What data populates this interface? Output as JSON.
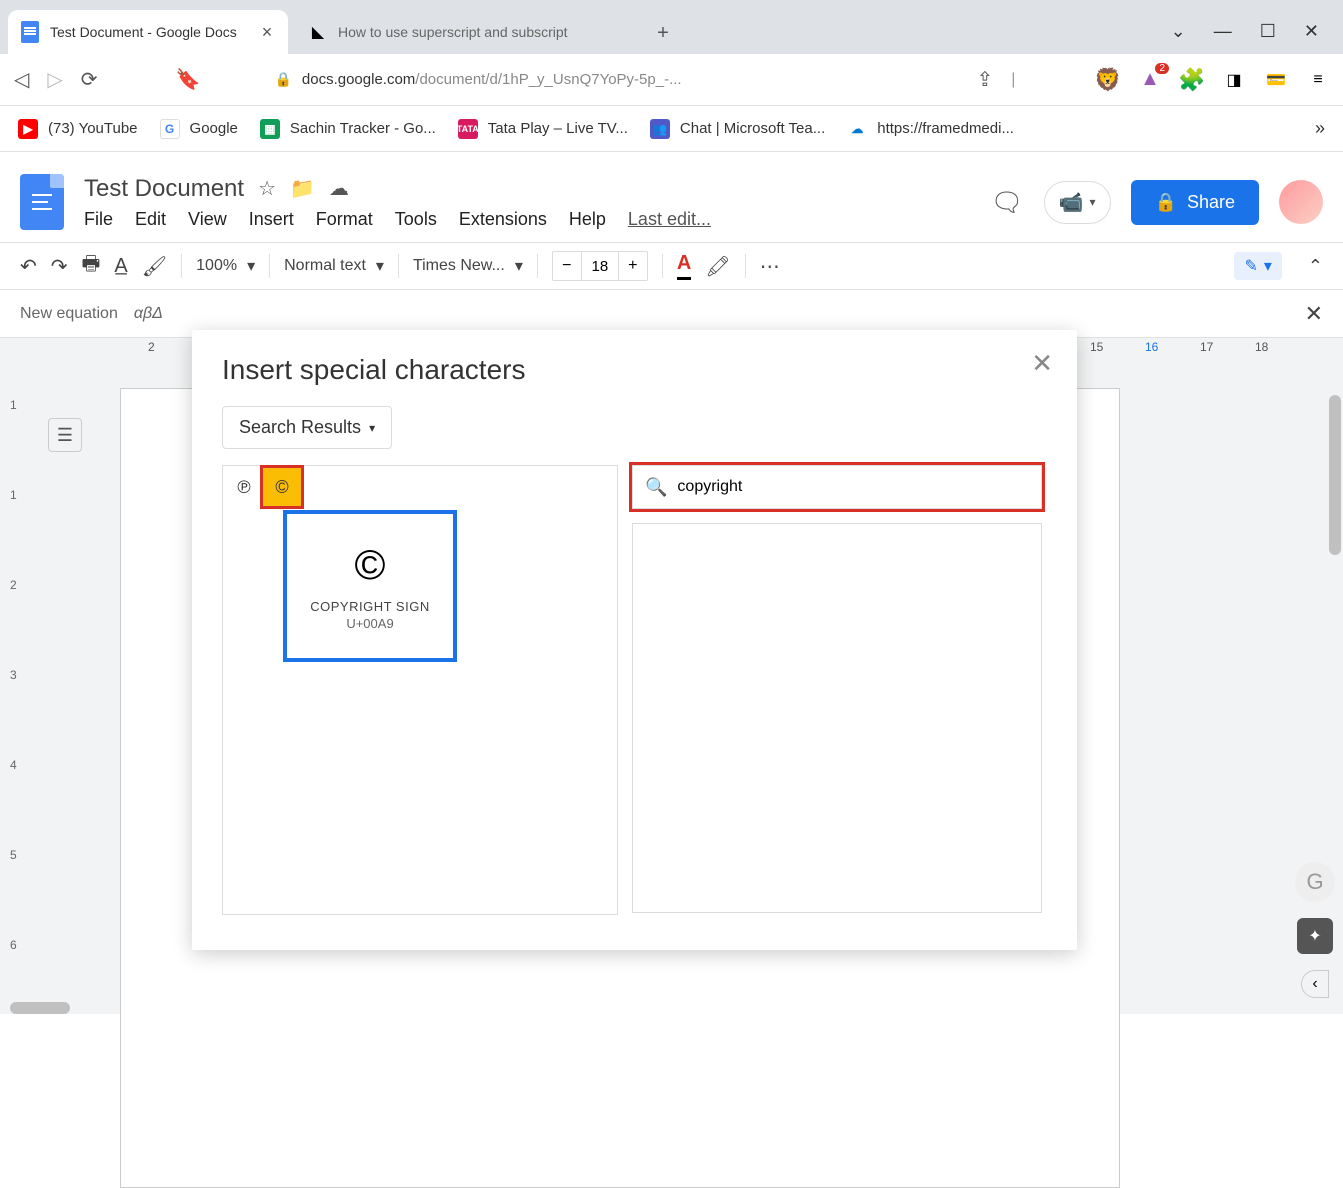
{
  "browser": {
    "tabs": [
      {
        "title": "Test Document - Google Docs",
        "active": true
      },
      {
        "title": "How to use superscript and subscript",
        "active": false
      }
    ],
    "url_host": "docs.google.com",
    "url_path": "/document/d/1hP_y_UsnQ7YoPy-5p_-...",
    "bookmarks": [
      {
        "label": "(73) YouTube",
        "color": "#ff0000",
        "glyph": "▶"
      },
      {
        "label": "Google",
        "color": "#fff",
        "glyph": "G"
      },
      {
        "label": "Sachin Tracker - Go...",
        "color": "#0f9d58",
        "glyph": "▦"
      },
      {
        "label": "Tata Play – Live TV...",
        "color": "#d81b60",
        "glyph": "T"
      },
      {
        "label": "Chat | Microsoft Tea...",
        "color": "#5059c9",
        "glyph": "👥"
      },
      {
        "label": "https://framedmedi...",
        "color": "#0078d4",
        "glyph": "☁"
      }
    ],
    "badge_count": "2"
  },
  "docs": {
    "title": "Test Document",
    "menus": [
      "File",
      "Edit",
      "View",
      "Insert",
      "Format",
      "Tools",
      "Extensions",
      "Help"
    ],
    "last_edit": "Last edit...",
    "share": "Share",
    "toolbar": {
      "zoom": "100%",
      "style": "Normal text",
      "font": "Times New...",
      "font_size": "18"
    },
    "equation_label": "New equation",
    "equation_symbols": "αβΔ"
  },
  "dialog": {
    "title": "Insert special characters",
    "category": "Search Results",
    "search_value": "copyright",
    "results": [
      {
        "glyph": "℗"
      },
      {
        "glyph": "©",
        "selected": true
      }
    ],
    "tooltip": {
      "glyph": "©",
      "name": "COPYRIGHT SIGN",
      "code": "U+00A9"
    }
  },
  "ruler_left": [
    "1",
    "1",
    "2",
    "3",
    "4",
    "5",
    "6"
  ],
  "ruler_top": [
    "2",
    "15",
    "16",
    "17",
    "18"
  ]
}
